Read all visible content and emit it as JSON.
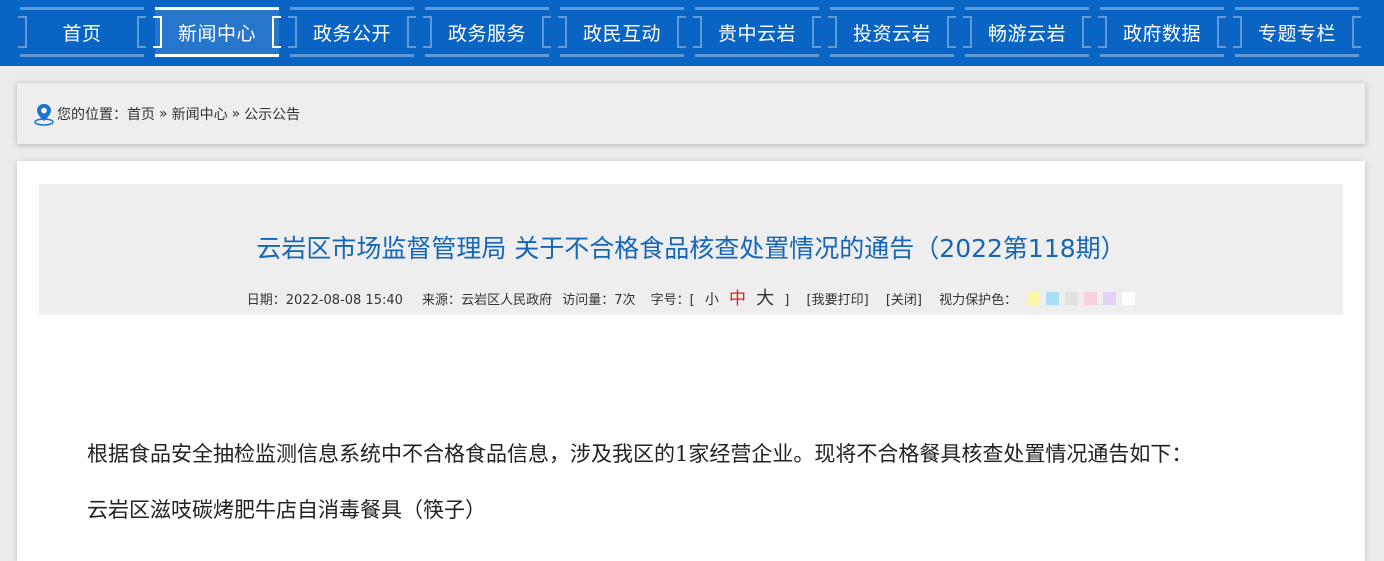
{
  "nav": {
    "items": [
      {
        "label": "首页"
      },
      {
        "label": "新闻中心"
      },
      {
        "label": "政务公开"
      },
      {
        "label": "政务服务"
      },
      {
        "label": "政民互动"
      },
      {
        "label": "贵中云岩"
      },
      {
        "label": "投资云岩"
      },
      {
        "label": "畅游云岩"
      },
      {
        "label": "政府数据"
      },
      {
        "label": "专题专栏"
      }
    ],
    "active_index": 1,
    "bar_color": "#0a64c4"
  },
  "breadcrumb": {
    "prefix": "您的位置：",
    "home": "首页",
    "separator": "»",
    "section": "新闻中心",
    "current": "公示公告",
    "icon": "location-pin-icon"
  },
  "article": {
    "title": "云岩区市场监督管理局 关于不合格食品核查处置情况的通告（2022第118期）",
    "meta": {
      "date_label": "日期：",
      "date": "2022-08-08 15:40",
      "source_label": "来源：",
      "source": "云岩区人民政府",
      "views_label": "访问量：",
      "views": "7次",
      "font_label": "字号：[",
      "font_small": "小",
      "font_mid": "中",
      "font_big": "大",
      "font_close": "]",
      "print": "[我要打印]",
      "close": "[关闭]",
      "eye_label": "视力保护色："
    },
    "eye_colors": [
      "#fbf6a8",
      "#a9ddf3",
      "#e2e2e2",
      "#f7cfe0",
      "#e2d2f6",
      "#ffffff"
    ],
    "paragraphs": [
      "根据食品安全抽检监测信息系统中不合格食品信息，涉及我区的1家经营企业。现将不合格餐具核查处置情况通告如下：",
      "云岩区滋吱碳烤肥牛店自消毒餐具（筷子）"
    ],
    "title_color": "#1565b8"
  }
}
